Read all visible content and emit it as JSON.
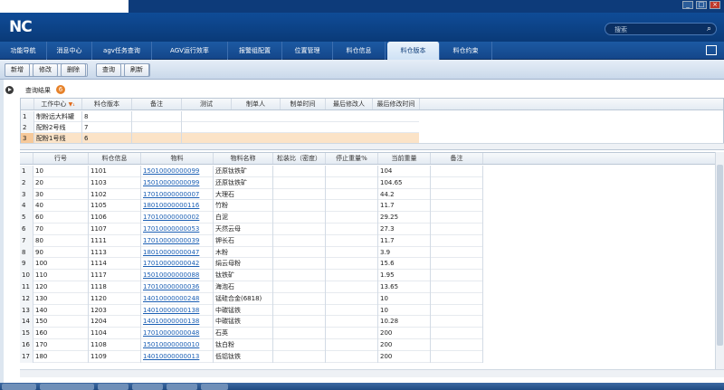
{
  "app": {
    "logo": "NC"
  },
  "search": {
    "placeholder": "搜索"
  },
  "window": {
    "min": "_",
    "max": "□",
    "close": "×"
  },
  "menu": {
    "items": [
      {
        "label": "功能导航"
      },
      {
        "label": "消息中心"
      },
      {
        "label": "agv任务查询"
      },
      {
        "label": "AGV运行效率"
      },
      {
        "label": "报警组配置"
      },
      {
        "label": "位置管理"
      },
      {
        "label": "料仓信息"
      },
      {
        "label": "料仓版本"
      },
      {
        "label": "料仓约束"
      }
    ],
    "active_index": 7
  },
  "toolbar": {
    "add": "新增",
    "edit": "修改",
    "delete": "删除",
    "query": "查询",
    "refresh": "刷新"
  },
  "result": {
    "label": "查询结果",
    "count": "6"
  },
  "upper": {
    "headers": [
      "工作中心",
      "料仓版本",
      "备注",
      "测试",
      "制单人",
      "制单时间",
      "最后修改人",
      "最后修改时间"
    ],
    "rows": [
      {
        "no": "1",
        "center": "制粉远大料罐",
        "version": "8"
      },
      {
        "no": "2",
        "center": "配粉2号线",
        "version": "7"
      },
      {
        "no": "3",
        "center": "配粉1号线",
        "version": "6"
      }
    ]
  },
  "lower": {
    "headers": [
      "行号",
      "料仓信息",
      "物料",
      "物料名称",
      "松装比（密度）",
      "停止重量%",
      "当前重量",
      "备注"
    ],
    "rows": [
      {
        "no": "1",
        "line": "10",
        "bin": "1101",
        "code": "15010000000099",
        "name": "还原钛铁矿",
        "weight": "104"
      },
      {
        "no": "2",
        "line": "20",
        "bin": "1103",
        "code": "15010000000099",
        "name": "还原钛铁矿",
        "weight": "104.65"
      },
      {
        "no": "3",
        "line": "30",
        "bin": "1102",
        "code": "17010000000007",
        "name": "大理石",
        "weight": "44.2"
      },
      {
        "no": "4",
        "line": "40",
        "bin": "1105",
        "code": "18010000000116",
        "name": "竹粉",
        "weight": "11.7"
      },
      {
        "no": "5",
        "line": "60",
        "bin": "1106",
        "code": "17010000000002",
        "name": "白泥",
        "weight": "29.25"
      },
      {
        "no": "6",
        "line": "70",
        "bin": "1107",
        "code": "17010000000053",
        "name": "天然云母",
        "weight": "27.3"
      },
      {
        "no": "7",
        "line": "80",
        "bin": "1111",
        "code": "17010000000039",
        "name": "钾长石",
        "weight": "11.7"
      },
      {
        "no": "8",
        "line": "90",
        "bin": "1113",
        "code": "18010000000047",
        "name": "木粉",
        "weight": "3.9"
      },
      {
        "no": "9",
        "line": "100",
        "bin": "1114",
        "code": "17010000000042",
        "name": "绢云母粉",
        "weight": "15.6"
      },
      {
        "no": "10",
        "line": "110",
        "bin": "1117",
        "code": "15010000000088",
        "name": "钛铁矿",
        "weight": "1.95"
      },
      {
        "no": "11",
        "line": "120",
        "bin": "1118",
        "code": "17010000000036",
        "name": "海泡石",
        "weight": "13.65"
      },
      {
        "no": "12",
        "line": "130",
        "bin": "1120",
        "code": "14010000000248",
        "name": "锰硅合金(6818)",
        "weight": "10"
      },
      {
        "no": "13",
        "line": "140",
        "bin": "1203",
        "code": "14010000000138",
        "name": "中碳锰铁",
        "weight": "10"
      },
      {
        "no": "14",
        "line": "150",
        "bin": "1204",
        "code": "14010000000138",
        "name": "中碳锰铁",
        "weight": "10.28"
      },
      {
        "no": "15",
        "line": "160",
        "bin": "1104",
        "code": "17010000000048",
        "name": "石英",
        "weight": "200"
      },
      {
        "no": "16",
        "line": "170",
        "bin": "1108",
        "code": "15010000000010",
        "name": "钛白粉",
        "weight": "200"
      },
      {
        "no": "17",
        "line": "180",
        "bin": "1109",
        "code": "14010000000013",
        "name": "低铝钛铁",
        "weight": "200"
      }
    ]
  },
  "colors": {
    "brand": "#0f4c97",
    "menu": "#1c5aa3",
    "link": "#1b5fb4",
    "badge": "#e6822a",
    "selected_row": "#fbe3c7"
  }
}
